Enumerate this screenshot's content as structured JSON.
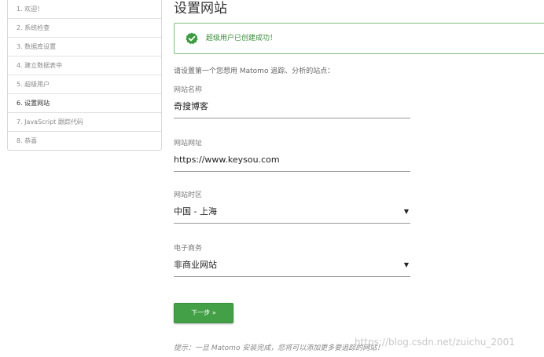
{
  "steps": [
    {
      "label": "1. 欢迎！"
    },
    {
      "label": "2. 系统检查"
    },
    {
      "label": "3. 数据库设置"
    },
    {
      "label": "4. 建立数据表中"
    },
    {
      "label": "5. 超级用户"
    },
    {
      "label": "6. 设置网站",
      "active": true
    },
    {
      "label": "7. JavaScript 跟踪代码"
    },
    {
      "label": "8. 恭喜"
    }
  ],
  "page_title": "设置网站",
  "alert": {
    "text": "超级用户已创建成功！",
    "icon": "success-check-icon"
  },
  "intro": "请设置第一个您想用 Matomo 追踪、分析的站点：",
  "form": {
    "site_name": {
      "label": "网站名称",
      "value": "奇搜博客"
    },
    "site_url": {
      "label": "网站网址",
      "value": "https://www.keysou.com"
    },
    "timezone": {
      "label": "网站时区",
      "value": "中国 - 上海"
    },
    "ecommerce": {
      "label": "电子商务",
      "value": "非商业网站"
    }
  },
  "next_button": "下一步 »",
  "tip": "提示：一旦 Matomo 安装完成，您将可以添加更多要追踪的网站！",
  "watermark": "https://blog.csdn.net/zuichu_2001",
  "colors": {
    "accent": "#43a047",
    "alert_border": "#7fbf7f"
  }
}
